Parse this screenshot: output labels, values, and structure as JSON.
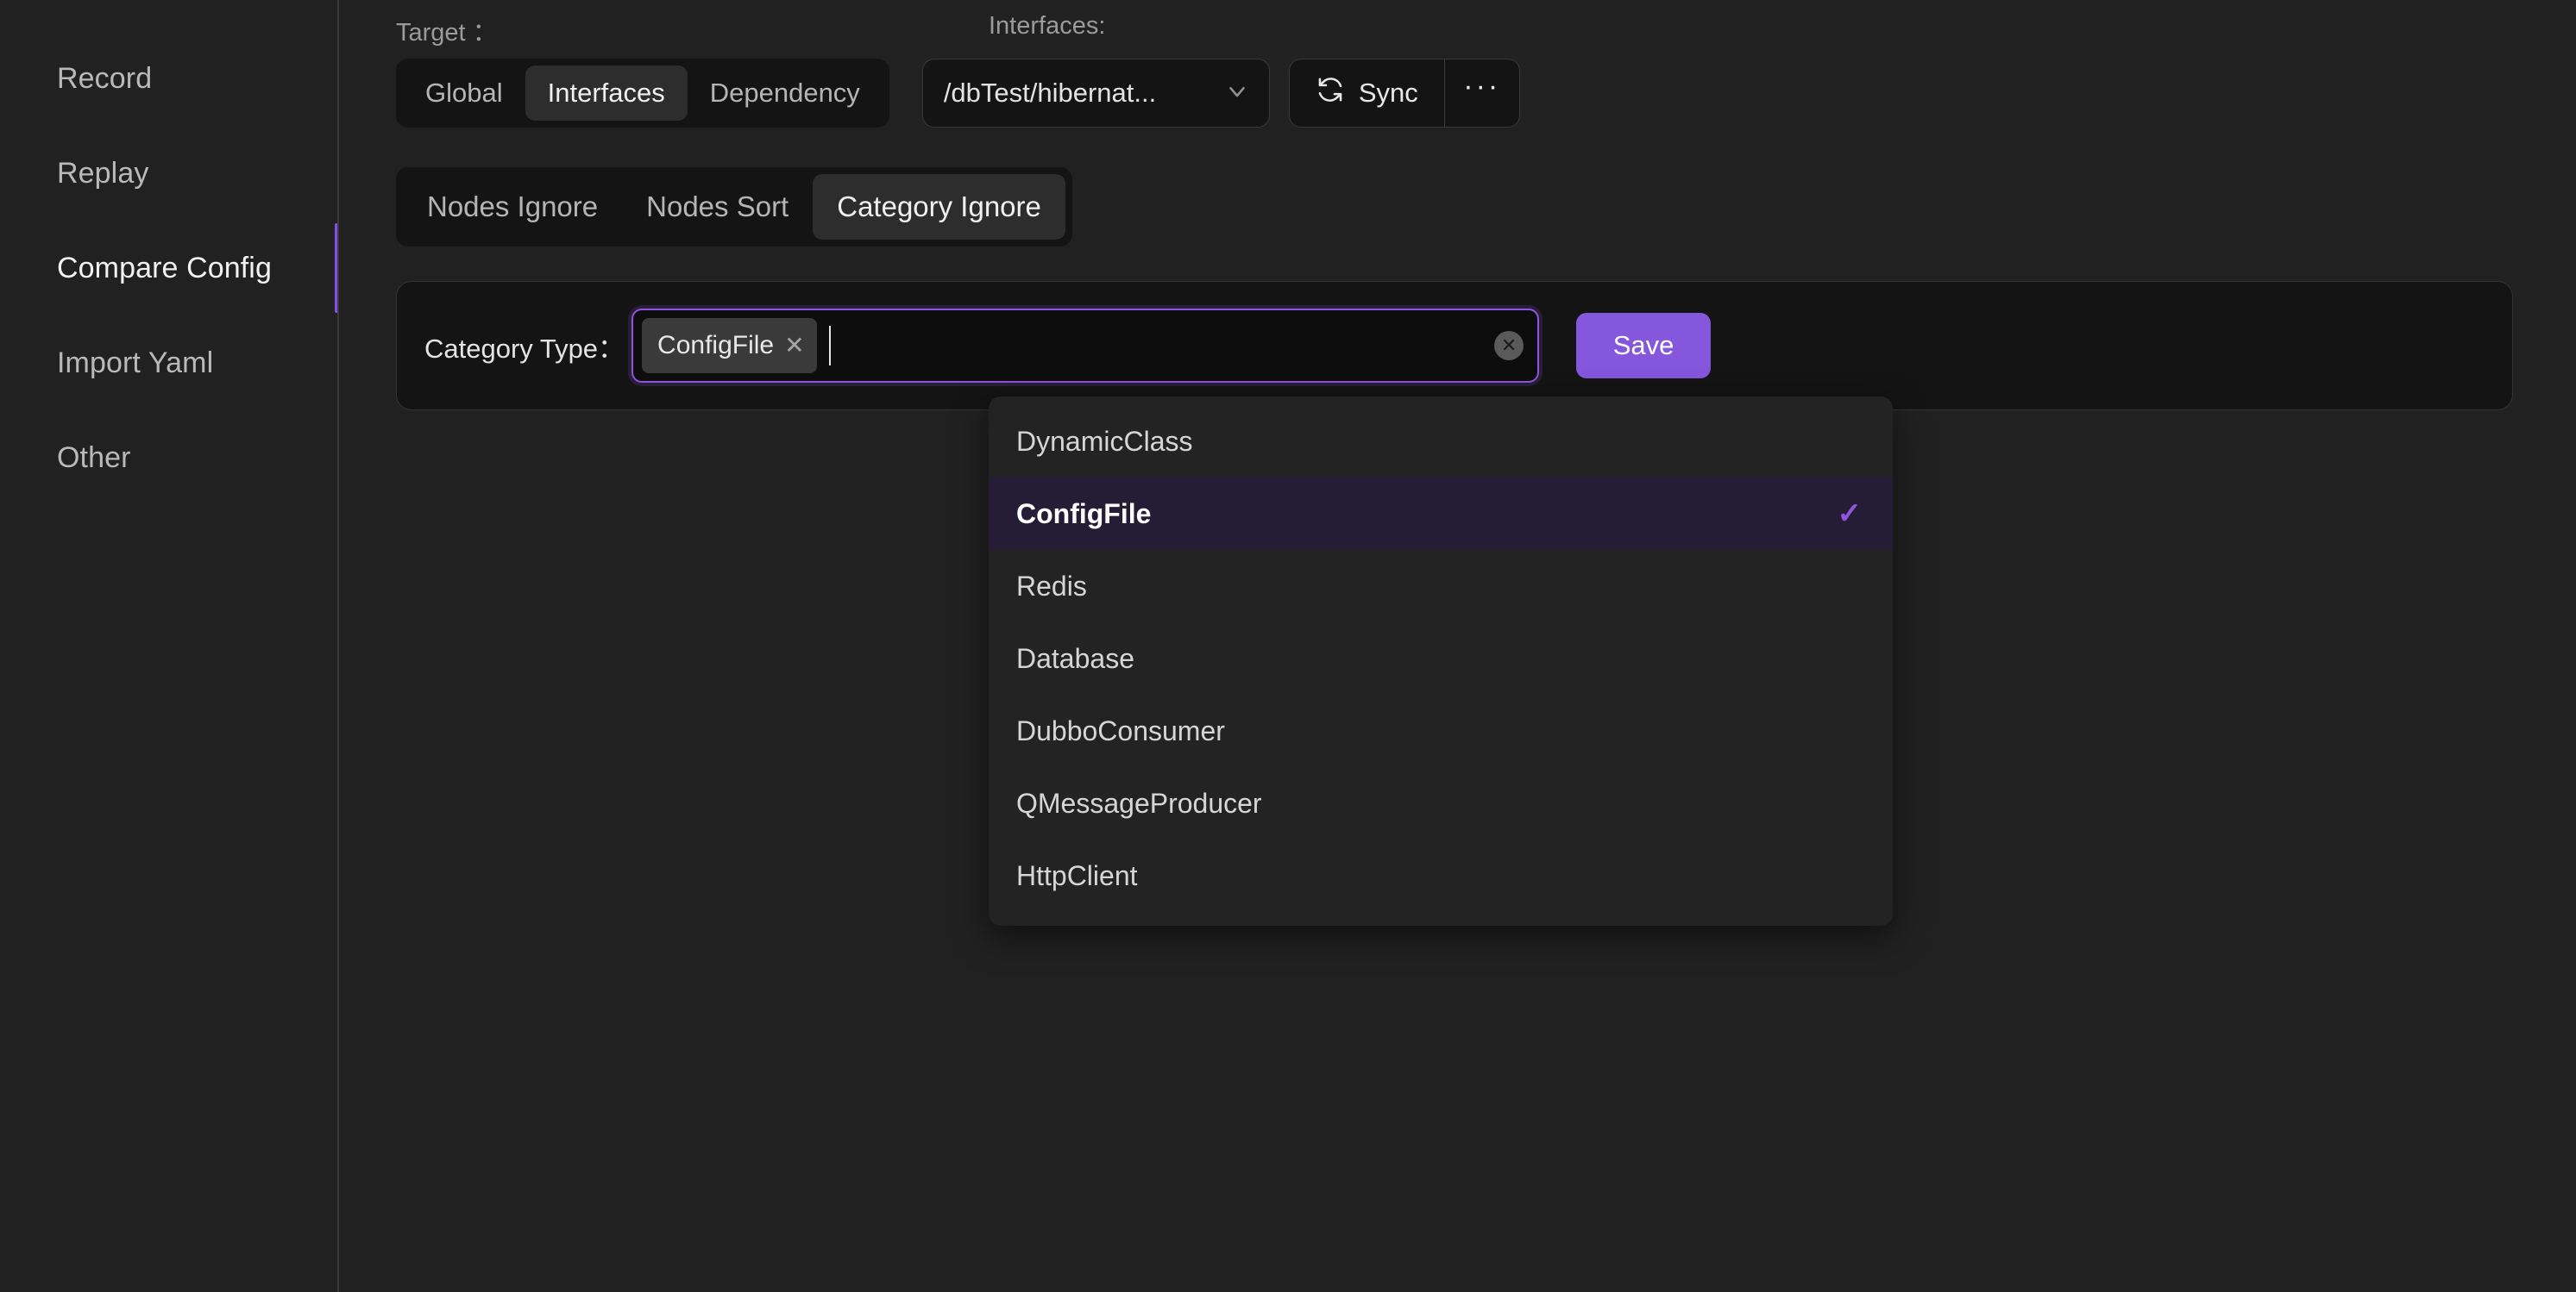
{
  "sidebar": {
    "items": [
      {
        "label": "Record",
        "active": false
      },
      {
        "label": "Replay",
        "active": false
      },
      {
        "label": "Compare Config",
        "active": true
      },
      {
        "label": "Import Yaml",
        "active": false
      },
      {
        "label": "Other",
        "active": false
      }
    ]
  },
  "toolbar": {
    "target_label": "Target ：",
    "interfaces_label": "Interfaces:",
    "target_tabs": [
      {
        "label": "Global",
        "active": false
      },
      {
        "label": "Interfaces",
        "active": true
      },
      {
        "label": "Dependency",
        "active": false
      }
    ],
    "interfaces_select": {
      "value": "/dbTest/hibernat...",
      "chevron_icon": "chevron-down-icon"
    },
    "sync_label": "Sync",
    "sync_icon": "refresh-icon",
    "more_label": "···",
    "more_icon": "ellipsis-icon"
  },
  "subtabs": [
    {
      "label": "Nodes Ignore",
      "active": false
    },
    {
      "label": "Nodes Sort",
      "active": false
    },
    {
      "label": "Category Ignore",
      "active": true
    }
  ],
  "config_panel": {
    "category_type_label": "Category Type：",
    "tags": [
      {
        "label": "ConfigFile",
        "remove_icon": "close-icon"
      }
    ],
    "input_placeholder": "",
    "clear_icon": "clear-circle-icon",
    "save_label": "Save"
  },
  "dropdown": {
    "options": [
      {
        "label": "DynamicClass",
        "selected": false
      },
      {
        "label": "ConfigFile",
        "selected": true
      },
      {
        "label": "Redis",
        "selected": false
      },
      {
        "label": "Database",
        "selected": false
      },
      {
        "label": "DubboConsumer",
        "selected": false
      },
      {
        "label": "QMessageProducer",
        "selected": false
      },
      {
        "label": "HttpClient",
        "selected": false
      }
    ],
    "check_icon": "check-icon"
  },
  "colors": {
    "accent": "#854eec",
    "save_button": "#8457dd",
    "background": "#212121",
    "panel": "#141414",
    "selected_row": "#251d35"
  }
}
